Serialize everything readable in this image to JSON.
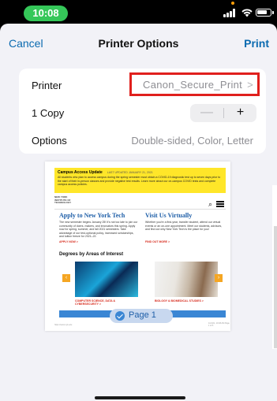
{
  "status_bar": {
    "time": "10:08"
  },
  "nav": {
    "cancel_label": "Cancel",
    "title": "Printer Options",
    "print_label": "Print"
  },
  "options": {
    "printer": {
      "label": "Printer",
      "value": "Canon_Secure_Print"
    },
    "copies": {
      "label": "1 Copy",
      "minus_label": "—",
      "plus_label": "+"
    },
    "options_row": {
      "label": "Options",
      "value": "Double-sided, Color, Letter"
    }
  },
  "preview": {
    "alert_title": "Campus Access Update",
    "alert_updated": "LAST UPDATED JANUARY 21, 2021",
    "alert_body": "All students who plan to access campus during the spring semester must obtain a COVID-19 diagnostic test up to seven days prior to the start of their in-person classes and provide negative test results. Learn more about our on-campus COVID tests and complete campus access policies.",
    "logo": "NEW YORK INSTITUTE OF TECHNOLOGY",
    "left_heading": "Apply to New York Tech",
    "left_body": "The new semester begins January 25! It's not too late to join our community of doers, makers, and innovators this spring. Apply now for spring, summer, and fall 2021 semesters. Take advantage of our test-optional policy, increased scholarships, and tuition freeze for 2021–22.",
    "left_link": "APPLY NOW >",
    "right_heading": "Visit Us Virtually",
    "right_body": "Whether you're a first-year, transfer student, attend our virtual events or an on-one appointment. Meet our students, advisors, and find out why New York Tech is the place for you!",
    "right_link": "FIND OUT MORE >",
    "degrees_heading": "Degrees by Areas of Interest",
    "degree_1": "COMPUTER SCIENCE, DATA & CYBERSECURITY >",
    "degree_2": "BIOLOGY & BIOMEDICAL STUDIES >",
    "footer_left": "https://www.nyit.edu",
    "footer_right": "1/21/21, 10:08 AM Page 1 of 5",
    "page_label": "Page 1"
  },
  "colors": {
    "accent": "#0a6ab0",
    "highlight": "#e0201d",
    "clock_pill": "#35c759"
  }
}
